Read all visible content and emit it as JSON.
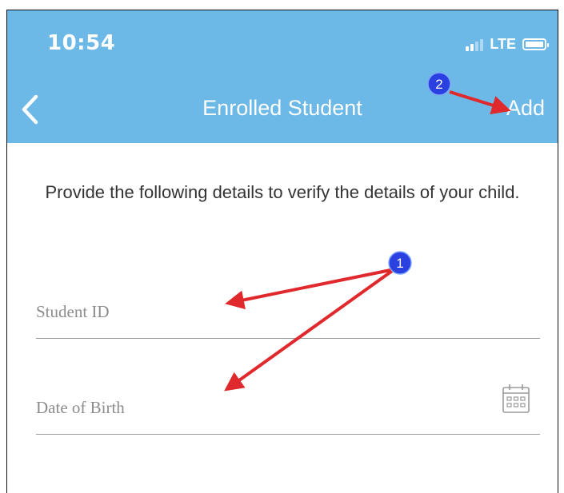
{
  "status_bar": {
    "time": "10:54",
    "network": "LTE"
  },
  "nav": {
    "back_icon": "chevron-left-icon",
    "title": "Enrolled Student",
    "add_label": "Add"
  },
  "intro_text": "Provide the following details to verify the details of your child.",
  "form": {
    "student_id": {
      "placeholder": "Student ID",
      "value": ""
    },
    "date_of_birth": {
      "placeholder": "Date of Birth",
      "value": "",
      "icon": "calendar-icon"
    }
  },
  "annotations": {
    "badge_1": "1",
    "badge_2": "2"
  },
  "colors": {
    "header": "#6cb8e6",
    "arrow": "#e0292c",
    "badge": "#2b40e0"
  }
}
